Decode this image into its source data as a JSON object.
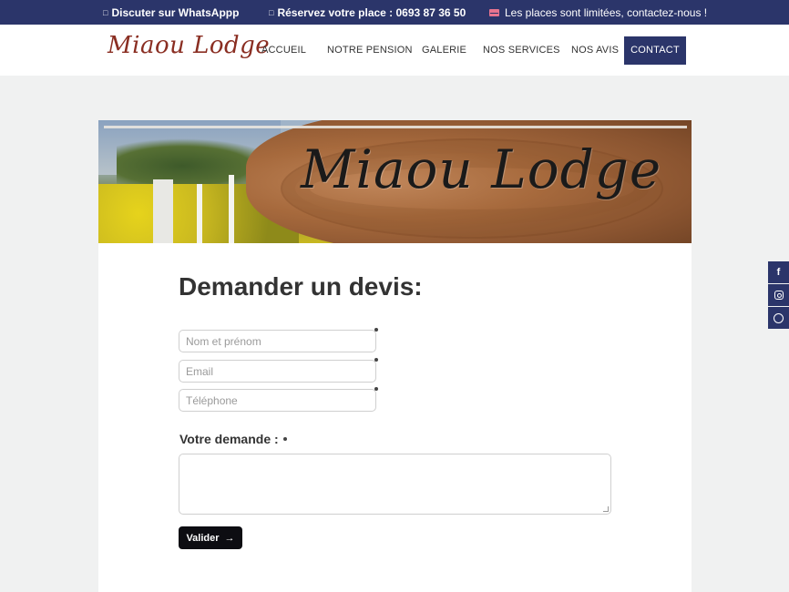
{
  "topbar": {
    "whatsapp_icon": "whatsapp-icon",
    "whatsapp_text": "Discuter sur WhatsAppp",
    "phone_icon": "phone-icon",
    "reservation_text": "Réservez votre place : 0693 87 36 50",
    "mail_icon": "envelope-icon",
    "info_text": "Les places sont limitées, contactez-nous !"
  },
  "header": {
    "logo_text": "Miaou Lodge",
    "nav": [
      {
        "label": "ACCUEIL"
      },
      {
        "label": "NOTRE PENSION"
      },
      {
        "label": "GALERIE"
      },
      {
        "label": "NOS SERVICES"
      },
      {
        "label": "NOS AVIS"
      },
      {
        "label": "CONTACT",
        "active": true
      }
    ]
  },
  "banner": {
    "sign_text": "Miaou Lodge"
  },
  "form": {
    "title": "Demander un devis:",
    "fields": [
      {
        "placeholder": "Nom et prénom",
        "value": ""
      },
      {
        "placeholder": "Email",
        "value": ""
      },
      {
        "placeholder": "Téléphone",
        "value": ""
      }
    ],
    "message_label": "Votre demande :",
    "submit_label": "Valider",
    "submit_icon": "arrow-right-icon"
  },
  "social": [
    "facebook-icon",
    "instagram-icon",
    "whatsapp-icon"
  ],
  "colors": {
    "primary_navy": "#2b356a",
    "logo_brown": "#8a2e22",
    "accent_pink": "#e8748f",
    "button_black": "#0d0d12"
  }
}
